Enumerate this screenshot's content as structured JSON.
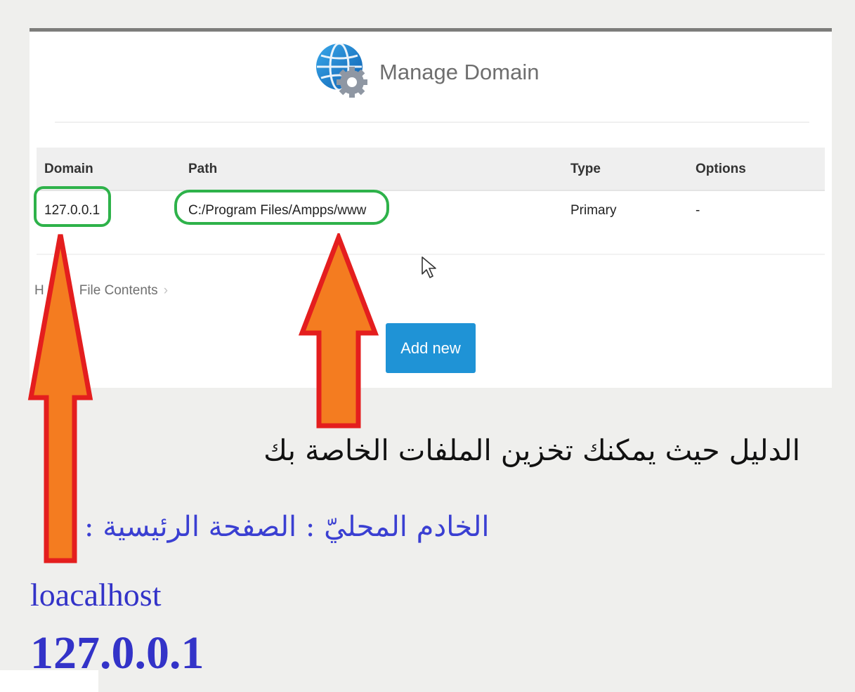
{
  "panel": {
    "title": "Manage Domain",
    "table": {
      "headers": [
        "Domain",
        "Path",
        "Type",
        "Options"
      ],
      "rows": [
        [
          "127.0.0.1",
          "C:/Program Files/Ampps/www",
          "Primary",
          "-"
        ]
      ]
    },
    "breadcrumb": {
      "visible_start": "H",
      "current": "File Contents"
    },
    "add_button_label": "Add new"
  },
  "annotations": {
    "path_caption": "الدليل حيث يمكنك تخزين الملفات الخاصة بك",
    "localhost_caption": "الخادم المحليّ : الصفحة الرئيسية :",
    "localhost_text": "loacalhost",
    "ip_text": "127.0.0.1",
    "colors": {
      "highlight_oval": "#2eb24a",
      "arrow_fill": "#f47c20",
      "arrow_stroke": "#e41e1e",
      "caption_blue": "#3a3fd2",
      "button_blue": "#1f93d6"
    }
  },
  "icons": [
    "globe-gear-icon",
    "mouse-cursor-icon",
    "chevron-right-icon"
  ]
}
